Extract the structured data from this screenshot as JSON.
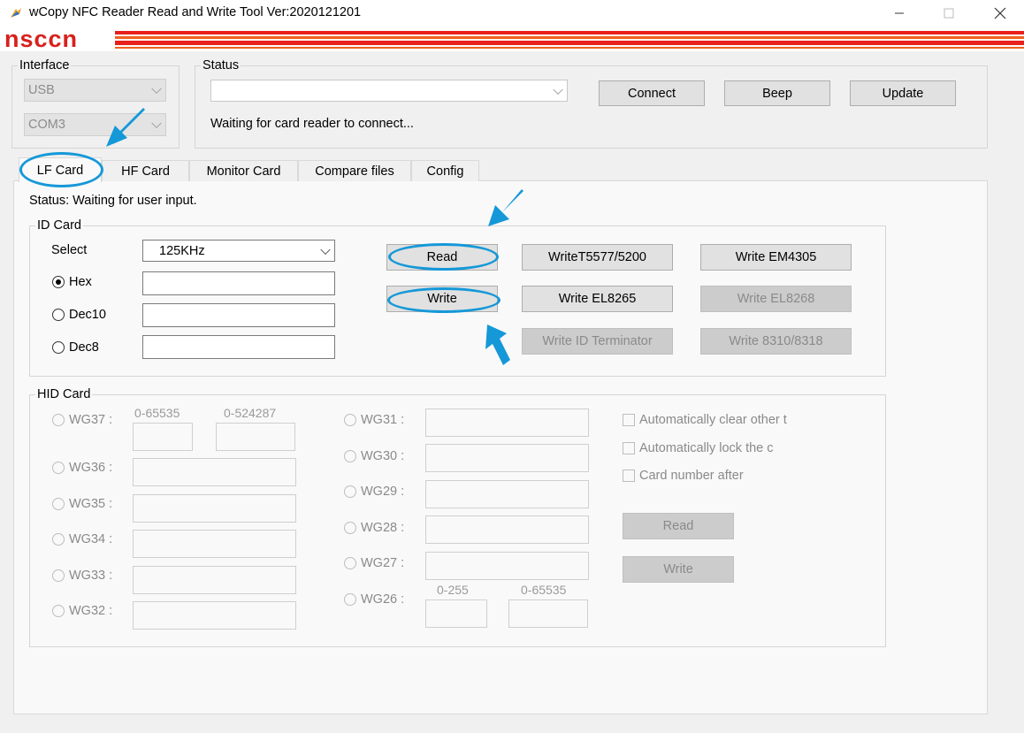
{
  "window": {
    "title": "wCopy NFC Reader Read and Write Tool  Ver:2020121201"
  },
  "banner": {
    "logo": "nsccn"
  },
  "interface": {
    "label": "Interface",
    "type_value": "USB",
    "port_value": "COM3"
  },
  "status_group": {
    "label": "Status",
    "device_value": "",
    "connect_label": "Connect",
    "beep_label": "Beep",
    "update_label": "Update",
    "message": "Waiting for card reader to connect..."
  },
  "tabs": [
    {
      "label": "LF Card"
    },
    {
      "label": "HF Card"
    },
    {
      "label": "Monitor Card"
    },
    {
      "label": "Compare files"
    },
    {
      "label": "Config"
    }
  ],
  "lf": {
    "status": "Status: Waiting for user input.",
    "id_card": {
      "label": "ID Card",
      "select_label": "Select",
      "select_value": "125KHz",
      "hex_label": "Hex",
      "dec10_label": "Dec10",
      "dec8_label": "Dec8",
      "hex_value": "",
      "dec10_value": "",
      "dec8_value": "",
      "buttons": {
        "read": "Read",
        "write": "Write",
        "t5577": "WriteT5577/5200",
        "em4305": "Write EM4305",
        "el8265": "Write EL8265",
        "el8268": "Write EL8268",
        "terminator": "Write ID Terminator",
        "w8310": "Write 8310/8318"
      }
    },
    "hid_card": {
      "label": "HID Card",
      "wg37": "WG37 :",
      "wg37_hint1": "0-65535",
      "wg37_hint2": "0-524287",
      "wg36": "WG36 :",
      "wg35": "WG35 :",
      "wg34": "WG34 :",
      "wg33": "WG33 :",
      "wg32": "WG32 :",
      "wg31": "WG31 :",
      "wg30": "WG30 :",
      "wg29": "WG29 :",
      "wg28": "WG28 :",
      "wg27": "WG27 :",
      "wg26": "WG26 :",
      "wg26_hint1": "0-255",
      "wg26_hint2": "0-65535",
      "opt_clear": "Automatically clear other t​",
      "opt_lock": "Automatically lock the c",
      "opt_after": "Card number after",
      "read": "Read",
      "write": "Write"
    }
  },
  "colors": {
    "accent_arrow": "#1598d8",
    "banner_red": "#e8201c"
  }
}
